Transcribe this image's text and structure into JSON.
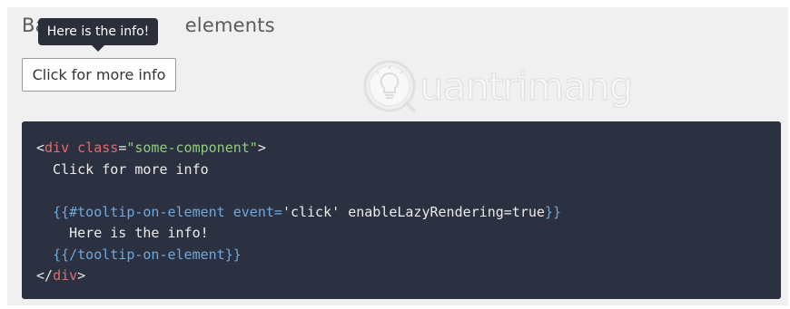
{
  "heading": {
    "prefix": "Ba",
    "suffix": "elements"
  },
  "tooltip": {
    "text": "Here is the info!"
  },
  "button": {
    "label": "Click for more info"
  },
  "watermark": {
    "text": "uantrimang"
  },
  "code": {
    "line1": {
      "open": "<",
      "tag": "div",
      "space": " ",
      "attr": "class",
      "eq": "=",
      "value": "\"some-component\"",
      "close": ">"
    },
    "line2": "  Click for more info",
    "line3": "",
    "line4": {
      "indent": "  ",
      "open": "{{",
      "helper": "#tooltip-on-element",
      "sp1": " ",
      "key1": "event=",
      "val1": "'click'",
      "sp2": " ",
      "rest": "enableLazyRendering=true",
      "close": "}}"
    },
    "line5": "    Here is the info!",
    "line6": {
      "indent": "  ",
      "open": "{{",
      "helper": "/tooltip-on-element",
      "close": "}}"
    },
    "line7": {
      "open": "</",
      "tag": "div",
      "close": ">"
    }
  },
  "colors": {
    "code_background": "#2b3140",
    "tag": "#e36b6b",
    "string": "#8fcf7a",
    "handlebars": "#6fa8dc",
    "tooltip_background": "#2b2f3a"
  }
}
